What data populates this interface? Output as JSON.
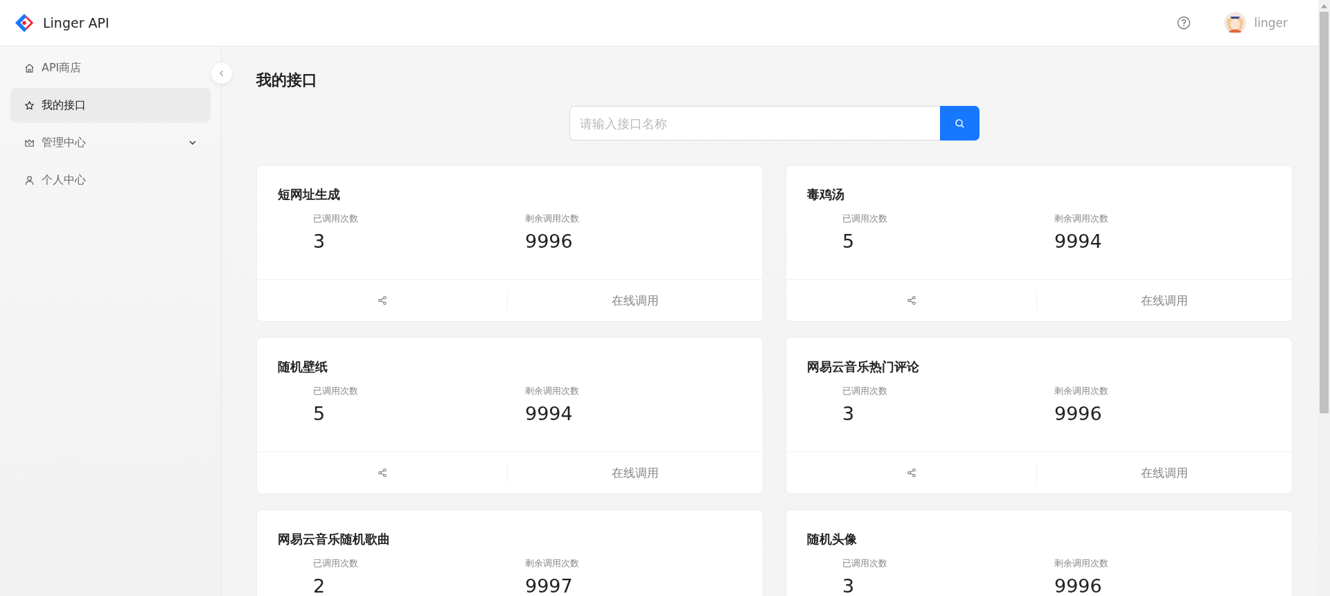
{
  "header": {
    "logo_text": "Linger API",
    "user_name": "linger"
  },
  "sidebar": {
    "items": [
      {
        "label": "API商店",
        "kind": "home",
        "selected": false
      },
      {
        "label": "我的接口",
        "kind": "star",
        "selected": true
      },
      {
        "label": "管理中心",
        "kind": "crown",
        "selected": false,
        "expanded": false
      },
      {
        "label": "个人中心",
        "kind": "user",
        "selected": false
      }
    ]
  },
  "page_title": "我的接口",
  "search": {
    "placeholder": "请输入接口名称"
  },
  "cards": [
    {
      "title": "短网址生成",
      "stats": [
        {
          "label": "已调用次数",
          "value": "3"
        },
        {
          "label": "剩余调用次数",
          "value": "9996"
        }
      ],
      "action": "在线调用"
    },
    {
      "title": "毒鸡汤",
      "stats": [
        {
          "label": "已调用次数",
          "value": "5"
        },
        {
          "label": "剩余调用次数",
          "value": "9994"
        }
      ],
      "action": "在线调用"
    },
    {
      "title": "随机壁纸",
      "stats": [
        {
          "label": "已调用次数",
          "value": "5"
        },
        {
          "label": "剩余调用次数",
          "value": "9994"
        }
      ],
      "action": "在线调用"
    },
    {
      "title": "网易云音乐热门评论",
      "stats": [
        {
          "label": "已调用次数",
          "value": "3"
        },
        {
          "label": "剩余调用次数",
          "value": "9996"
        }
      ],
      "action": "在线调用"
    },
    {
      "title": "网易云音乐随机歌曲",
      "stats": [
        {
          "label": "已调用次数",
          "value": "2"
        },
        {
          "label": "剩余调用次数",
          "value": "9997"
        }
      ]
    },
    {
      "title": "随机头像",
      "stats": [
        {
          "label": "已调用次数",
          "value": "3"
        },
        {
          "label": "剩余调用次数",
          "value": "9996"
        }
      ]
    }
  ]
}
